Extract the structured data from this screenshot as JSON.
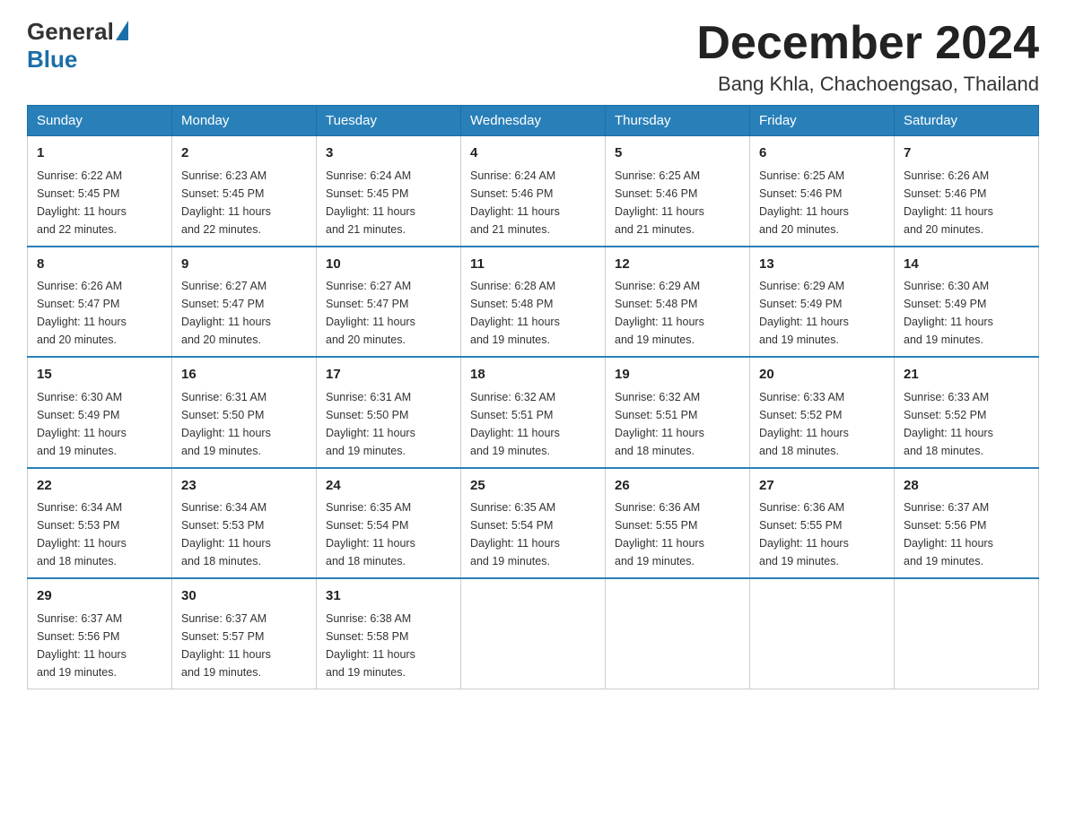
{
  "header": {
    "logo_general": "General",
    "logo_blue": "Blue",
    "title": "December 2024",
    "location": "Bang Khla, Chachoengsao, Thailand"
  },
  "weekdays": [
    "Sunday",
    "Monday",
    "Tuesday",
    "Wednesday",
    "Thursday",
    "Friday",
    "Saturday"
  ],
  "weeks": [
    [
      {
        "day": "1",
        "sunrise": "6:22 AM",
        "sunset": "5:45 PM",
        "daylight": "11 hours and 22 minutes."
      },
      {
        "day": "2",
        "sunrise": "6:23 AM",
        "sunset": "5:45 PM",
        "daylight": "11 hours and 22 minutes."
      },
      {
        "day": "3",
        "sunrise": "6:24 AM",
        "sunset": "5:45 PM",
        "daylight": "11 hours and 21 minutes."
      },
      {
        "day": "4",
        "sunrise": "6:24 AM",
        "sunset": "5:46 PM",
        "daylight": "11 hours and 21 minutes."
      },
      {
        "day": "5",
        "sunrise": "6:25 AM",
        "sunset": "5:46 PM",
        "daylight": "11 hours and 21 minutes."
      },
      {
        "day": "6",
        "sunrise": "6:25 AM",
        "sunset": "5:46 PM",
        "daylight": "11 hours and 20 minutes."
      },
      {
        "day": "7",
        "sunrise": "6:26 AM",
        "sunset": "5:46 PM",
        "daylight": "11 hours and 20 minutes."
      }
    ],
    [
      {
        "day": "8",
        "sunrise": "6:26 AM",
        "sunset": "5:47 PM",
        "daylight": "11 hours and 20 minutes."
      },
      {
        "day": "9",
        "sunrise": "6:27 AM",
        "sunset": "5:47 PM",
        "daylight": "11 hours and 20 minutes."
      },
      {
        "day": "10",
        "sunrise": "6:27 AM",
        "sunset": "5:47 PM",
        "daylight": "11 hours and 20 minutes."
      },
      {
        "day": "11",
        "sunrise": "6:28 AM",
        "sunset": "5:48 PM",
        "daylight": "11 hours and 19 minutes."
      },
      {
        "day": "12",
        "sunrise": "6:29 AM",
        "sunset": "5:48 PM",
        "daylight": "11 hours and 19 minutes."
      },
      {
        "day": "13",
        "sunrise": "6:29 AM",
        "sunset": "5:49 PM",
        "daylight": "11 hours and 19 minutes."
      },
      {
        "day": "14",
        "sunrise": "6:30 AM",
        "sunset": "5:49 PM",
        "daylight": "11 hours and 19 minutes."
      }
    ],
    [
      {
        "day": "15",
        "sunrise": "6:30 AM",
        "sunset": "5:49 PM",
        "daylight": "11 hours and 19 minutes."
      },
      {
        "day": "16",
        "sunrise": "6:31 AM",
        "sunset": "5:50 PM",
        "daylight": "11 hours and 19 minutes."
      },
      {
        "day": "17",
        "sunrise": "6:31 AM",
        "sunset": "5:50 PM",
        "daylight": "11 hours and 19 minutes."
      },
      {
        "day": "18",
        "sunrise": "6:32 AM",
        "sunset": "5:51 PM",
        "daylight": "11 hours and 19 minutes."
      },
      {
        "day": "19",
        "sunrise": "6:32 AM",
        "sunset": "5:51 PM",
        "daylight": "11 hours and 18 minutes."
      },
      {
        "day": "20",
        "sunrise": "6:33 AM",
        "sunset": "5:52 PM",
        "daylight": "11 hours and 18 minutes."
      },
      {
        "day": "21",
        "sunrise": "6:33 AM",
        "sunset": "5:52 PM",
        "daylight": "11 hours and 18 minutes."
      }
    ],
    [
      {
        "day": "22",
        "sunrise": "6:34 AM",
        "sunset": "5:53 PM",
        "daylight": "11 hours and 18 minutes."
      },
      {
        "day": "23",
        "sunrise": "6:34 AM",
        "sunset": "5:53 PM",
        "daylight": "11 hours and 18 minutes."
      },
      {
        "day": "24",
        "sunrise": "6:35 AM",
        "sunset": "5:54 PM",
        "daylight": "11 hours and 18 minutes."
      },
      {
        "day": "25",
        "sunrise": "6:35 AM",
        "sunset": "5:54 PM",
        "daylight": "11 hours and 19 minutes."
      },
      {
        "day": "26",
        "sunrise": "6:36 AM",
        "sunset": "5:55 PM",
        "daylight": "11 hours and 19 minutes."
      },
      {
        "day": "27",
        "sunrise": "6:36 AM",
        "sunset": "5:55 PM",
        "daylight": "11 hours and 19 minutes."
      },
      {
        "day": "28",
        "sunrise": "6:37 AM",
        "sunset": "5:56 PM",
        "daylight": "11 hours and 19 minutes."
      }
    ],
    [
      {
        "day": "29",
        "sunrise": "6:37 AM",
        "sunset": "5:56 PM",
        "daylight": "11 hours and 19 minutes."
      },
      {
        "day": "30",
        "sunrise": "6:37 AM",
        "sunset": "5:57 PM",
        "daylight": "11 hours and 19 minutes."
      },
      {
        "day": "31",
        "sunrise": "6:38 AM",
        "sunset": "5:58 PM",
        "daylight": "11 hours and 19 minutes."
      },
      null,
      null,
      null,
      null
    ]
  ],
  "labels": {
    "sunrise": "Sunrise:",
    "sunset": "Sunset:",
    "daylight": "Daylight:"
  }
}
